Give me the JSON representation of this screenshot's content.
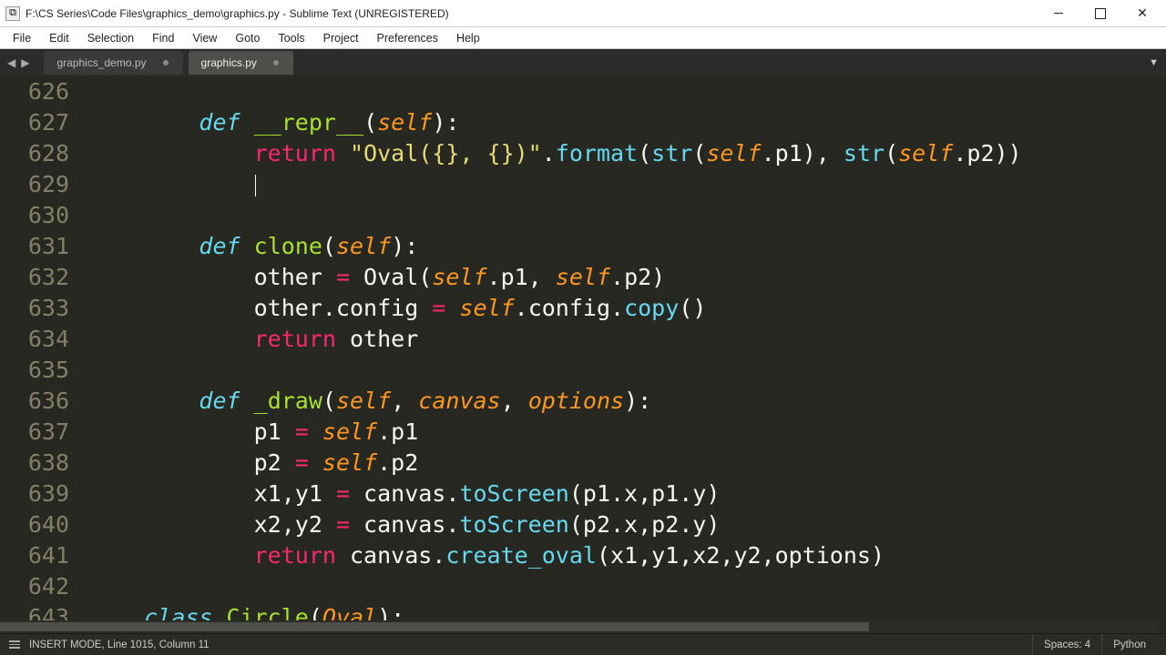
{
  "window": {
    "title": "F:\\CS Series\\Code Files\\graphics_demo\\graphics.py - Sublime Text (UNREGISTERED)"
  },
  "menu": {
    "items": [
      "File",
      "Edit",
      "Selection",
      "Find",
      "View",
      "Goto",
      "Tools",
      "Project",
      "Preferences",
      "Help"
    ]
  },
  "tabs": [
    {
      "label": "graphics_demo.py",
      "active": false,
      "dirty": true
    },
    {
      "label": "graphics.py",
      "active": true,
      "dirty": true
    }
  ],
  "gutter_start": 626,
  "gutter_count": 18,
  "code_lines": [
    {
      "indent": 0,
      "segs": []
    },
    {
      "indent": 2,
      "segs": [
        {
          "t": "def ",
          "c": "kw"
        },
        {
          "t": "__repr__",
          "c": "fn"
        },
        {
          "t": "(",
          "c": "pn"
        },
        {
          "t": "self",
          "c": "prm"
        },
        {
          "t": "):",
          "c": "pn"
        }
      ]
    },
    {
      "indent": 3,
      "segs": [
        {
          "t": "return",
          "c": "kw2"
        },
        {
          "t": " ",
          "c": "pn"
        },
        {
          "t": "\"Oval({}, {})\"",
          "c": "str"
        },
        {
          "t": ".",
          "c": "pn"
        },
        {
          "t": "format",
          "c": "call"
        },
        {
          "t": "(",
          "c": "pn"
        },
        {
          "t": "str",
          "c": "call"
        },
        {
          "t": "(",
          "c": "pn"
        },
        {
          "t": "self",
          "c": "prm"
        },
        {
          "t": ".p1), ",
          "c": "pn"
        },
        {
          "t": "str",
          "c": "call"
        },
        {
          "t": "(",
          "c": "pn"
        },
        {
          "t": "self",
          "c": "prm"
        },
        {
          "t": ".p2))",
          "c": "pn"
        }
      ]
    },
    {
      "indent": 0,
      "segs": [],
      "cursor_at": 3
    },
    {
      "indent": 0,
      "segs": []
    },
    {
      "indent": 2,
      "segs": [
        {
          "t": "def ",
          "c": "kw"
        },
        {
          "t": "clone",
          "c": "fn"
        },
        {
          "t": "(",
          "c": "pn"
        },
        {
          "t": "self",
          "c": "prm"
        },
        {
          "t": "):",
          "c": "pn"
        }
      ]
    },
    {
      "indent": 3,
      "segs": [
        {
          "t": "other ",
          "c": "pn"
        },
        {
          "t": "=",
          "c": "op"
        },
        {
          "t": " Oval(",
          "c": "pn"
        },
        {
          "t": "self",
          "c": "prm"
        },
        {
          "t": ".p1, ",
          "c": "pn"
        },
        {
          "t": "self",
          "c": "prm"
        },
        {
          "t": ".p2)",
          "c": "pn"
        }
      ]
    },
    {
      "indent": 3,
      "segs": [
        {
          "t": "other.config ",
          "c": "pn"
        },
        {
          "t": "=",
          "c": "op"
        },
        {
          "t": " ",
          "c": "pn"
        },
        {
          "t": "self",
          "c": "prm"
        },
        {
          "t": ".config.",
          "c": "pn"
        },
        {
          "t": "copy",
          "c": "call"
        },
        {
          "t": "()",
          "c": "pn"
        }
      ]
    },
    {
      "indent": 3,
      "segs": [
        {
          "t": "return",
          "c": "kw2"
        },
        {
          "t": " other",
          "c": "pn"
        }
      ]
    },
    {
      "indent": 0,
      "segs": []
    },
    {
      "indent": 2,
      "segs": [
        {
          "t": "def ",
          "c": "kw"
        },
        {
          "t": "_draw",
          "c": "fn"
        },
        {
          "t": "(",
          "c": "pn"
        },
        {
          "t": "self",
          "c": "prm"
        },
        {
          "t": ", ",
          "c": "pn"
        },
        {
          "t": "canvas",
          "c": "prm"
        },
        {
          "t": ", ",
          "c": "pn"
        },
        {
          "t": "options",
          "c": "prm"
        },
        {
          "t": "):",
          "c": "pn"
        }
      ]
    },
    {
      "indent": 3,
      "segs": [
        {
          "t": "p1 ",
          "c": "pn"
        },
        {
          "t": "=",
          "c": "op"
        },
        {
          "t": " ",
          "c": "pn"
        },
        {
          "t": "self",
          "c": "prm"
        },
        {
          "t": ".p1",
          "c": "pn"
        }
      ]
    },
    {
      "indent": 3,
      "segs": [
        {
          "t": "p2 ",
          "c": "pn"
        },
        {
          "t": "=",
          "c": "op"
        },
        {
          "t": " ",
          "c": "pn"
        },
        {
          "t": "self",
          "c": "prm"
        },
        {
          "t": ".p2",
          "c": "pn"
        }
      ]
    },
    {
      "indent": 3,
      "segs": [
        {
          "t": "x1,y1 ",
          "c": "pn"
        },
        {
          "t": "=",
          "c": "op"
        },
        {
          "t": " canvas.",
          "c": "pn"
        },
        {
          "t": "toScreen",
          "c": "call"
        },
        {
          "t": "(p1.x,p1.y)",
          "c": "pn"
        }
      ]
    },
    {
      "indent": 3,
      "segs": [
        {
          "t": "x2,y2 ",
          "c": "pn"
        },
        {
          "t": "=",
          "c": "op"
        },
        {
          "t": " canvas.",
          "c": "pn"
        },
        {
          "t": "toScreen",
          "c": "call"
        },
        {
          "t": "(p2.x,p2.y)",
          "c": "pn"
        }
      ]
    },
    {
      "indent": 3,
      "segs": [
        {
          "t": "return",
          "c": "kw2"
        },
        {
          "t": " canvas.",
          "c": "pn"
        },
        {
          "t": "create_oval",
          "c": "call"
        },
        {
          "t": "(x1,y1,x2,y2,options)",
          "c": "pn"
        }
      ]
    },
    {
      "indent": 0,
      "segs": []
    },
    {
      "indent": 1,
      "segs": [
        {
          "t": "class ",
          "c": "kw"
        },
        {
          "t": "Circle",
          "c": "fn"
        },
        {
          "t": "(",
          "c": "pn"
        },
        {
          "t": "Oval",
          "c": "prm"
        },
        {
          "t": "):",
          "c": "pn"
        }
      ]
    }
  ],
  "status": {
    "mode_text": "INSERT MODE, Line 1015, Column 11",
    "spaces": "Spaces: 4",
    "lang": "Python"
  }
}
